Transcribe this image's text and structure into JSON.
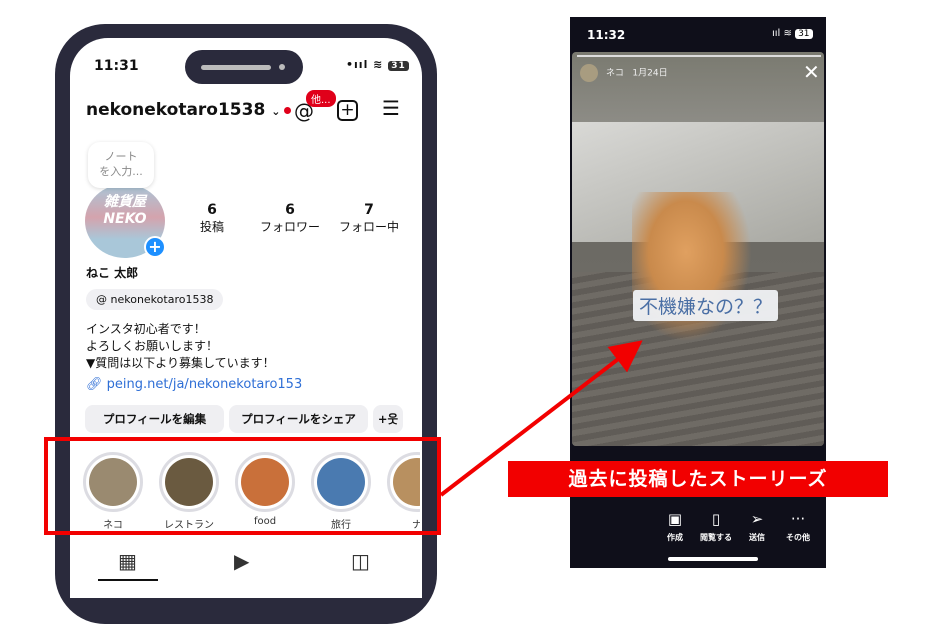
{
  "profile": {
    "time": "11:31",
    "signal": "•ııl ≋",
    "battery": "31",
    "username": "nekonekotaro1538",
    "threads_badge": "他...",
    "note": "ノート\nを入力...",
    "avatar_text": "雑貨屋\nNEKO",
    "stats": [
      {
        "value": "6",
        "label": "投稿"
      },
      {
        "value": "6",
        "label": "フォロワー"
      },
      {
        "value": "7",
        "label": "フォロー中"
      }
    ],
    "name": "ねこ 太郎",
    "threads_handle": "nekonekotaro1538",
    "bio": [
      "インスタ初心者です！",
      "よろしくお願いします！",
      "▼質問は以下より募集しています！"
    ],
    "link": "peing.net/ja/nekonekotaro153",
    "edit_button": "プロフィールを編集",
    "share_button": "プロフィールをシェア",
    "highlights": [
      {
        "label": "ネコ",
        "color": "#9a8a70"
      },
      {
        "label": "レストラン",
        "color": "#6a5a40"
      },
      {
        "label": "food",
        "color": "#c9703a"
      },
      {
        "label": "旅行",
        "color": "#4a7ab0"
      },
      {
        "label": "ナ",
        "color": "#b89060"
      }
    ]
  },
  "story": {
    "time": "11:32",
    "battery": "31",
    "user": "ネコ",
    "date": "1月24日",
    "caption": "不機嫌なの？？",
    "actions": [
      {
        "icon": "reel-icon",
        "label": "作成"
      },
      {
        "icon": "view-icon",
        "label": "閲覧する"
      },
      {
        "icon": "send-icon",
        "label": "送信"
      },
      {
        "icon": "more-icon",
        "label": "その他"
      }
    ]
  },
  "annotation": {
    "label": "過去に投稿したストーリーズ",
    "color": "#f20000"
  }
}
